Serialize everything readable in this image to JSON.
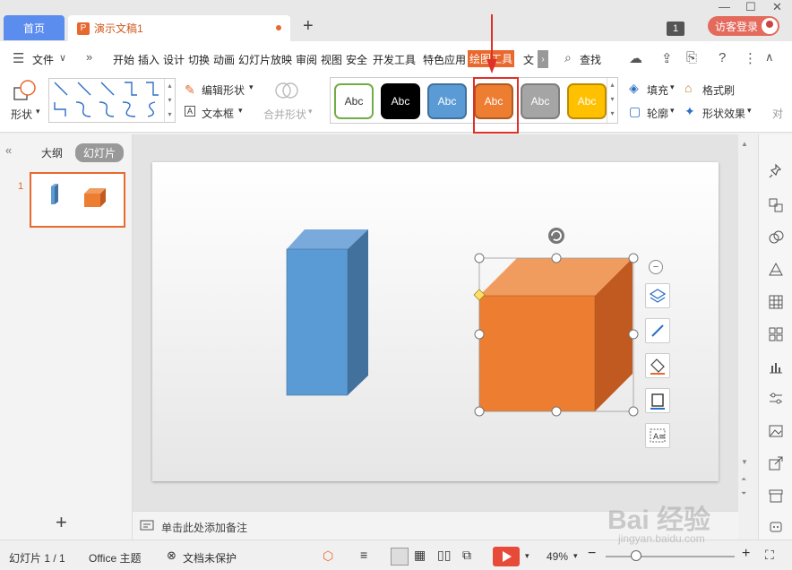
{
  "titlebar": {
    "home_tab": "首页",
    "doc_tab": "演示文稿1",
    "badge": "1",
    "login": "访客登录"
  },
  "menu": {
    "file": "文件",
    "items": [
      "开始",
      "插入",
      "设计",
      "切换",
      "动画",
      "幻灯片放映",
      "审阅",
      "视图",
      "安全",
      "开发工具",
      "特色应用",
      "绘图工具",
      "文"
    ],
    "search": "查找"
  },
  "ribbon": {
    "shape": "形状",
    "edit_shape": "编辑形状",
    "text_box": "文本框",
    "merge_shape": "合并形状",
    "styles": [
      {
        "label": "Abc",
        "bg": "#ffffff",
        "fg": "#333333",
        "border": "#70ad47"
      },
      {
        "label": "Abc",
        "bg": "#000000",
        "fg": "#ffffff",
        "border": "#000000"
      },
      {
        "label": "Abc",
        "bg": "#5b9bd5",
        "fg": "#ffffff",
        "border": "#41719c"
      },
      {
        "label": "Abc",
        "bg": "#ed7d31",
        "fg": "#ffffff",
        "border": "#ae5a21"
      },
      {
        "label": "Abc",
        "bg": "#a5a5a5",
        "fg": "#ffffff",
        "border": "#7f7f7f"
      },
      {
        "label": "Abc",
        "bg": "#ffc000",
        "fg": "#ffffff",
        "border": "#bc8c00"
      }
    ],
    "fill": "填充",
    "format_painter": "格式刷",
    "outline": "轮廓",
    "shape_effect": "形状效果",
    "cut_text": "对"
  },
  "leftpanel": {
    "outline_tab": "大纲",
    "slides_tab": "幻灯片",
    "slide_number": "1"
  },
  "notes": {
    "placeholder": "单击此处添加备注"
  },
  "status": {
    "slide_count": "幻灯片 1 / 1",
    "theme": "Office 主题",
    "protection": "文档未保护",
    "zoom": "49%"
  },
  "watermark": {
    "text": "Bai 经验",
    "url": "jingyan.baidu.com"
  },
  "colors": {
    "accent": "#e8682d",
    "blue_shape": "#5b9bd5",
    "orange_shape": "#ed7d31",
    "highlight": "#e0302a"
  }
}
